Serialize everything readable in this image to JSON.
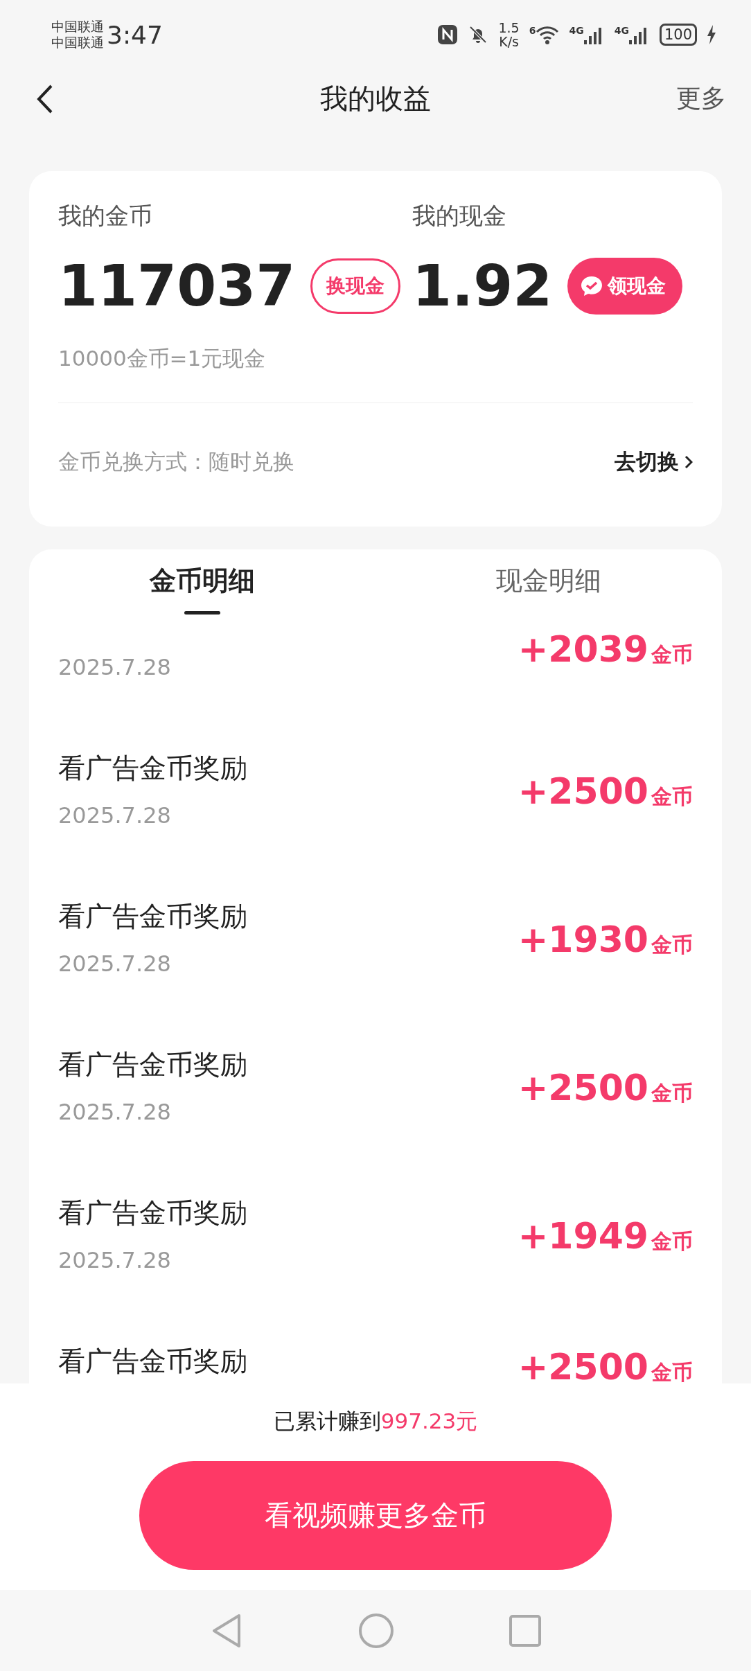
{
  "status_bar": {
    "carriers": [
      "中国联通",
      "中国联通"
    ],
    "time": "3:47",
    "net_speed": {
      "value": "1.5",
      "unit": "K/s"
    },
    "wifi_label": "6",
    "signals": [
      {
        "label": "4G"
      },
      {
        "label": "4G"
      }
    ],
    "battery": "100"
  },
  "header": {
    "title": "我的收益",
    "action": "更多"
  },
  "balance_card": {
    "coins": {
      "label": "我的金币",
      "value": "117037",
      "button": "换现金"
    },
    "cash": {
      "label": "我的现金",
      "value": "1.92",
      "button": "领现金"
    },
    "rate": "10000金币=1元现金",
    "exchange": {
      "label": "金币兑换方式：",
      "mode": "随时兑换",
      "link": "去切换"
    }
  },
  "tabs": [
    {
      "label": "金币明细",
      "selected": true
    },
    {
      "label": "现金明细",
      "selected": false
    }
  ],
  "records": [
    {
      "date": "2025.7.28",
      "amount": "+2039",
      "unit": "金币"
    },
    {
      "title": "看广告金币奖励",
      "date": "2025.7.28",
      "amount": "+2500",
      "unit": "金币"
    },
    {
      "title": "看广告金币奖励",
      "date": "2025.7.28",
      "amount": "+1930",
      "unit": "金币"
    },
    {
      "title": "看广告金币奖励",
      "date": "2025.7.28",
      "amount": "+2500",
      "unit": "金币"
    },
    {
      "title": "看广告金币奖励",
      "date": "2025.7.28",
      "amount": "+1949",
      "unit": "金币"
    },
    {
      "title": "看广告金币奖励",
      "amount": "+2500",
      "unit": "金币"
    }
  ],
  "footer": {
    "summary": "已累计赚到",
    "total": "997.23元",
    "button": "看视频赚更多金币"
  }
}
